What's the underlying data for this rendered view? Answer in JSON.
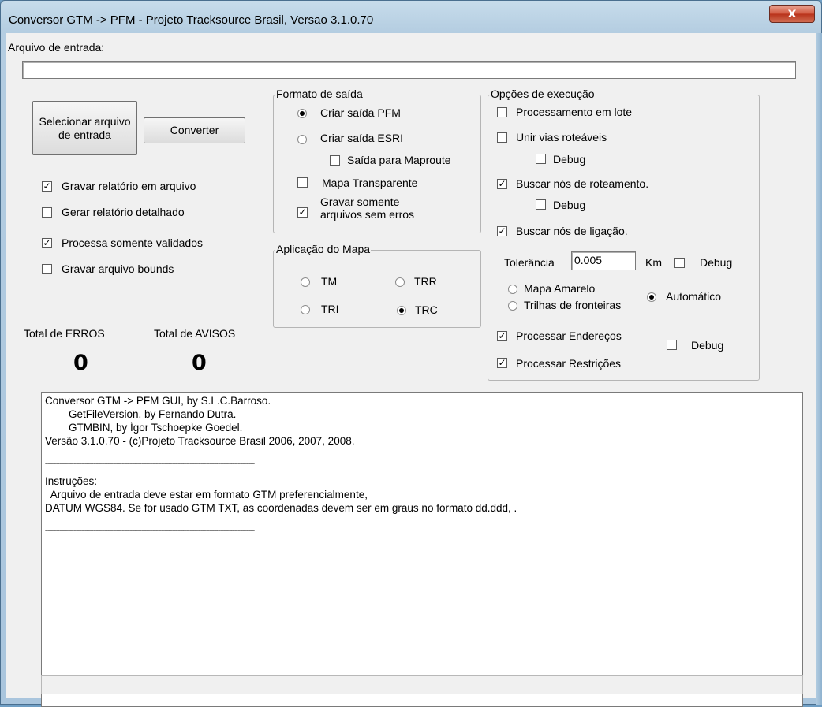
{
  "window": {
    "title": "Conversor GTM -> PFM - Projeto Tracksource Brasil, Versao 3.1.0.70",
    "close_glyph": "x"
  },
  "input": {
    "label": "Arquivo de entrada:",
    "value": ""
  },
  "buttons": {
    "select_file": "Selecionar arquivo de entrada",
    "convert": "Converter"
  },
  "left_options": [
    {
      "label": "Gravar relatório em arquivo",
      "checked": true
    },
    {
      "label": "Gerar relatório detalhado",
      "checked": false
    },
    {
      "label": "Processa somente validados",
      "checked": true
    },
    {
      "label": "Gravar arquivo bounds",
      "checked": false
    }
  ],
  "output_format": {
    "title": "Formato de saída",
    "pfm": {
      "label": "Criar saída PFM",
      "selected": true
    },
    "esri": {
      "label": "Criar saída ESRI",
      "selected": false
    },
    "maproute": {
      "label": "Saída para Maproute",
      "checked": false
    },
    "transparent": {
      "label": "Mapa Transparente",
      "checked": false
    },
    "no_errors": {
      "label": "Gravar somente arquivos sem erros",
      "checked": true
    }
  },
  "map_application": {
    "title": "Aplicação do Mapa",
    "tm": {
      "label": "TM",
      "selected": false
    },
    "trr": {
      "label": "TRR",
      "selected": false
    },
    "tri": {
      "label": "TRI",
      "selected": false
    },
    "trc": {
      "label": "TRC",
      "selected": true
    }
  },
  "execution": {
    "title": "Opções de execução",
    "batch": {
      "label": "Processamento em lote",
      "checked": false
    },
    "join_routes": {
      "label": "Unir vias roteáveis",
      "checked": false
    },
    "join_debug": {
      "label": "Debug",
      "checked": false
    },
    "routing_nodes": {
      "label": "Buscar nós de roteamento.",
      "checked": true
    },
    "routing_debug": {
      "label": "Debug",
      "checked": false
    },
    "link_nodes": {
      "label": "Buscar nós de ligação.",
      "checked": true
    },
    "tolerance_label": "Tolerância",
    "tolerance_value": "0.005",
    "tolerance_unit": "Km",
    "tolerance_debug": {
      "label": "Debug",
      "checked": false
    },
    "yellow_map": {
      "label": "Mapa Amarelo",
      "selected": false
    },
    "border_trails": {
      "label": "Trilhas de fronteiras",
      "selected": false
    },
    "automatic": {
      "label": "Automático",
      "selected": true
    },
    "addresses": {
      "label": "Processar Endereços",
      "checked": true
    },
    "addresses_debug": {
      "label": "Debug",
      "checked": false
    },
    "restrictions": {
      "label": "Processar Restrições",
      "checked": true
    }
  },
  "totals": {
    "errors_label": "Total de ERROS",
    "errors_value": "0",
    "warnings_label": "Total de AVISOS",
    "warnings_value": "0"
  },
  "log": [
    "Conversor GTM -> PFM GUI, by S.L.C.Barroso.",
    "        GetFileVersion, by Fernando Dutra.",
    "        GTMBIN, by Ígor Tschoepke Goedel.",
    "Versão 3.1.0.70 - (c)Projeto Tracksource Brasil 2006, 2007, 2008.",
    "",
    "~~~~~~~~~~~~~~~~~~~~~~~~~~~~~~~~~~~~~~~~~~~~~~~~~~~~~~~~~~~~~~~~~~~~~~~~~~",
    "Instruções:",
    "  Arquivo de entrada deve estar em formato GTM preferencialmente,",
    "DATUM WGS84. Se for usado GTM TXT, as coordenadas devem ser em graus no formato dd.ddd, .",
    "",
    "~~~~~~~~~~~~~~~~~~~~~~~~~~~~~~~~~~~~~~~~~~~~~~~~~~~~~~~~~~~~~~~~~~~~~~~~~~"
  ],
  "status_text": ""
}
